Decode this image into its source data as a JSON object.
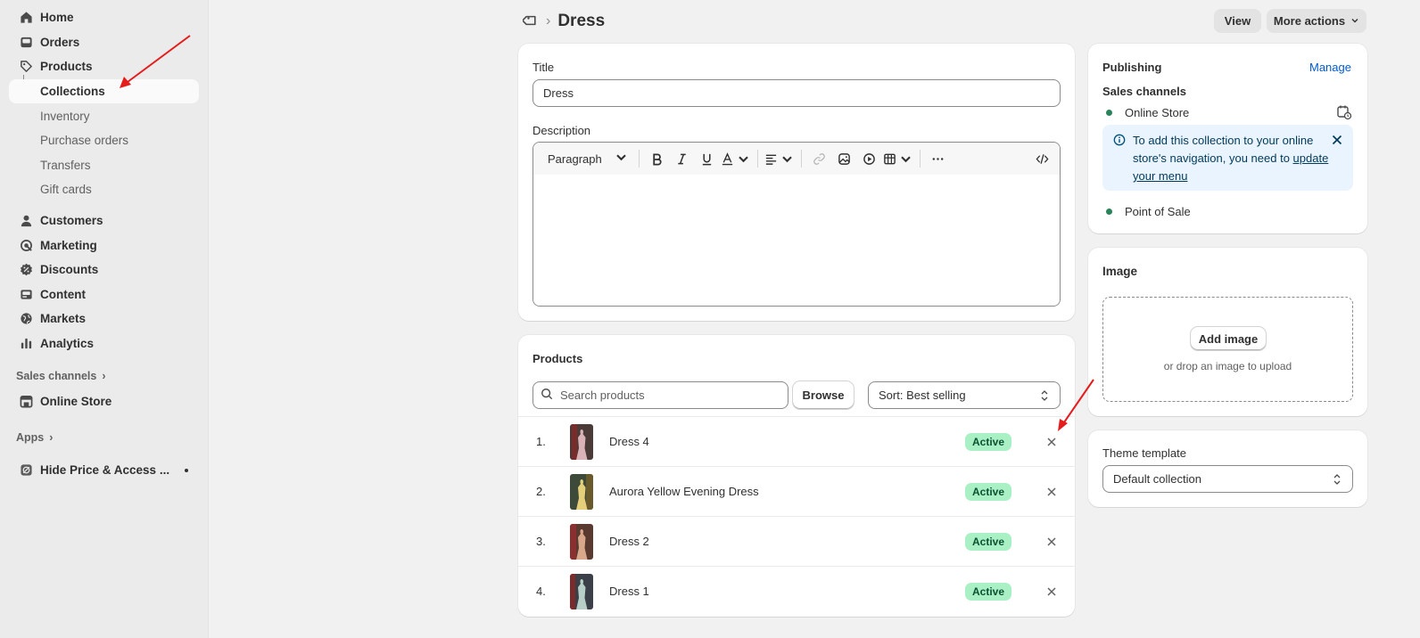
{
  "sidebar": {
    "items": [
      {
        "label": "Home",
        "icon": "home-icon"
      },
      {
        "label": "Orders",
        "icon": "inbox-icon"
      },
      {
        "label": "Products",
        "icon": "tag-icon"
      },
      {
        "label": "Collections"
      },
      {
        "label": "Inventory"
      },
      {
        "label": "Purchase orders"
      },
      {
        "label": "Transfers"
      },
      {
        "label": "Gift cards"
      },
      {
        "label": "Customers",
        "icon": "person-icon"
      },
      {
        "label": "Marketing",
        "icon": "target-icon"
      },
      {
        "label": "Discounts",
        "icon": "discount-icon"
      },
      {
        "label": "Content",
        "icon": "content-icon"
      },
      {
        "label": "Markets",
        "icon": "globe-icon"
      },
      {
        "label": "Analytics",
        "icon": "bar-chart-icon"
      }
    ],
    "sales_channels_label": "Sales channels",
    "online_store_label": "Online Store",
    "apps_label": "Apps",
    "app_item_label": "Hide Price & Access ..."
  },
  "header": {
    "title": "Dress",
    "view_label": "View",
    "more_actions_label": "More actions"
  },
  "details": {
    "title_label": "Title",
    "title_value": "Dress",
    "description_label": "Description",
    "paragraph_label": "Paragraph"
  },
  "products": {
    "heading": "Products",
    "search_placeholder": "Search products",
    "browse_label": "Browse",
    "sort_label": "Sort: Best selling",
    "rows": [
      {
        "num": "1.",
        "name": "Dress 4",
        "status": "Active"
      },
      {
        "num": "2.",
        "name": "Aurora Yellow Evening Dress",
        "status": "Active"
      },
      {
        "num": "3.",
        "name": "Dress 2",
        "status": "Active"
      },
      {
        "num": "4.",
        "name": "Dress 1",
        "status": "Active"
      }
    ]
  },
  "publishing": {
    "heading": "Publishing",
    "manage_label": "Manage",
    "sales_channels_label": "Sales channels",
    "online_store": "Online Store",
    "banner_text_1": "To add this collection to your online store's navigation, you need to ",
    "banner_link": "update your menu",
    "point_of_sale": "Point of Sale"
  },
  "image": {
    "heading": "Image",
    "add_label": "Add image",
    "drop_text": "or drop an image to upload"
  },
  "theme": {
    "label": "Theme template",
    "value": "Default collection"
  },
  "colors": {
    "active_badge_bg": "#a9f0c4",
    "active_badge_text": "#0c5132",
    "link": "#005bd3",
    "annotation_arrow": "#e51c1c",
    "channel_dot": "#29845a"
  }
}
